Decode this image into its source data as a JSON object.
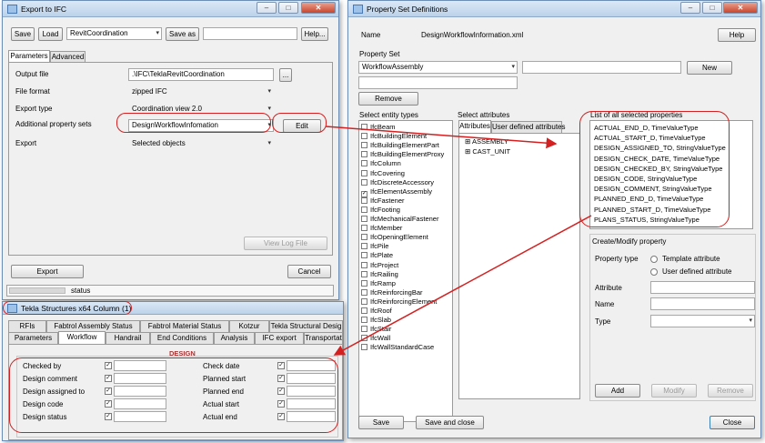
{
  "export_window": {
    "title": "Export to IFC",
    "top_buttons": {
      "save": "Save",
      "load": "Load",
      "preset": "RevitCoordination",
      "save_as": "Save as",
      "help": "Help..."
    },
    "tabs": [
      "Parameters",
      "Advanced"
    ],
    "fields": [
      {
        "label": "Output file",
        "value": ".\\IFC\\TeklaRevitCoordination"
      },
      {
        "label": "File format",
        "value": "zipped IFC"
      },
      {
        "label": "Export type",
        "value": "Coordination view 2.0"
      },
      {
        "label": "Additional property sets",
        "value": "DesignWorkflowInfomation"
      },
      {
        "label": "Export",
        "value": "Selected objects"
      }
    ],
    "browse_label": "...",
    "edit_label": "Edit",
    "view_log_label": "View Log File",
    "export_label": "Export",
    "cancel_label": "Cancel",
    "status_label": "status"
  },
  "tekla_window": {
    "title": "Tekla Structures x64  Column (1)",
    "tabs_row1": [
      "RFIs",
      "Fabtrol Assembly Status",
      "Fabtrol Material Status",
      "Kotzur",
      "Tekla Structural Desig"
    ],
    "tabs_row2": [
      "Parameters",
      "Workflow",
      "Handrail",
      "End Conditions",
      "Analysis",
      "IFC export",
      "Transportat"
    ],
    "group_title": "DESIGN",
    "left_fields": [
      "Checked by",
      "Design comment",
      "Design assigned to",
      "Design code",
      "Design status"
    ],
    "right_fields": [
      "Check date",
      "Planned start",
      "Planned end",
      "Actual start",
      "Actual end"
    ],
    "check_mark": "✓"
  },
  "psd_window": {
    "title": "Property Set Definitions",
    "name_label": "Name",
    "name_value": "DesignWorkflowInformation.xml",
    "help_label": "Help",
    "property_set_label": "Property Set",
    "property_set_value": "WorkflowAssembly",
    "new_label": "New",
    "remove_label": "Remove",
    "entity_types_label": "Select entity types",
    "entity_types": [
      {
        "name": "IfcBeam",
        "checked": false
      },
      {
        "name": "IfcBuildingElement",
        "checked": false
      },
      {
        "name": "IfcBuildingElementPart",
        "checked": false
      },
      {
        "name": "IfcBuildingElementProxy",
        "checked": false
      },
      {
        "name": "IfcColumn",
        "checked": false
      },
      {
        "name": "IfcCovering",
        "checked": false
      },
      {
        "name": "IfcDiscreteAccessory",
        "checked": false
      },
      {
        "name": "IfcElementAssembly",
        "checked": true
      },
      {
        "name": "IfcFastener",
        "checked": false
      },
      {
        "name": "IfcFooting",
        "checked": false
      },
      {
        "name": "IfcMechanicalFastener",
        "checked": false
      },
      {
        "name": "IfcMember",
        "checked": false
      },
      {
        "name": "IfcOpeningElement",
        "checked": false
      },
      {
        "name": "IfcPile",
        "checked": false
      },
      {
        "name": "IfcPlate",
        "checked": false
      },
      {
        "name": "IfcProject",
        "checked": false
      },
      {
        "name": "IfcRailing",
        "checked": false
      },
      {
        "name": "IfcRamp",
        "checked": false
      },
      {
        "name": "IfcReinforcingBar",
        "checked": false
      },
      {
        "name": "IfcReinforcingElement",
        "checked": false
      },
      {
        "name": "IfcRoof",
        "checked": false
      },
      {
        "name": "IfcSlab",
        "checked": false
      },
      {
        "name": "IfcStair",
        "checked": false
      },
      {
        "name": "IfcWall",
        "checked": false
      },
      {
        "name": "IfcWallStandardCase",
        "checked": false
      }
    ],
    "attributes_label": "Select attributes",
    "attribute_tabs": [
      "Attributes",
      "User defined attributes"
    ],
    "attribute_tree": [
      "ASSEMBLY",
      "CAST_UNIT"
    ],
    "selected_props_label": "List of all selected properties",
    "selected_props": [
      "ACTUAL_END_D,  TimeValueType",
      "ACTUAL_START_D,  TimeValueType",
      "DESIGN_ASSIGNED_TO,  StringValueType",
      "DESIGN_CHECK_DATE,  TimeValueType",
      "DESIGN_CHECKED_BY,  StringValueType",
      "DESIGN_CODE,  StringValueType",
      "DESIGN_COMMENT,  StringValueType",
      "PLANNED_END_D,  TimeValueType",
      "PLANNED_START_D,  TimeValueType",
      "PLANS_STATUS,  StringValueType"
    ],
    "create_modify_label": "Create/Modify property",
    "property_type_label": "Property type",
    "template_attr_label": "Template attribute",
    "user_defined_attr_label": "User defined attribute",
    "attribute_label": "Attribute",
    "name_field_label": "Name",
    "type_label": "Type",
    "add_label": "Add",
    "modify_label": "Modify",
    "remove2_label": "Remove",
    "save_label": "Save",
    "save_close_label": "Save and close",
    "close_label": "Close"
  },
  "colors": {
    "annotation": "#d42020",
    "titlebar": "#c8dbef"
  }
}
